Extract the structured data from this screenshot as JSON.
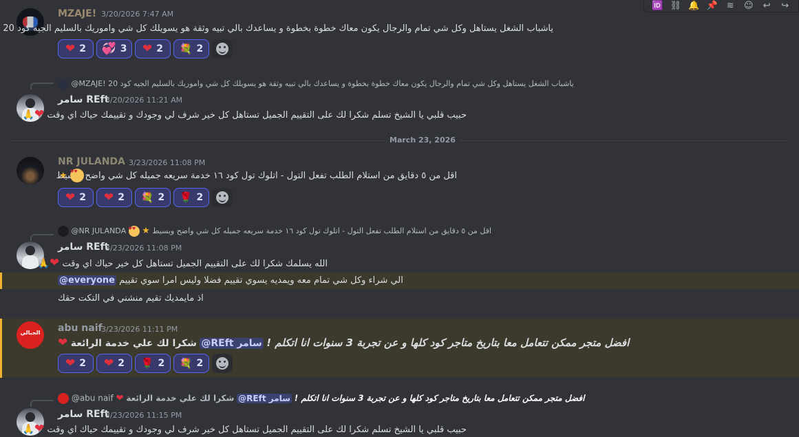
{
  "toolbar": {
    "icons": [
      "id-icon",
      "link-icon",
      "bell-icon",
      "pin-icon",
      "threads-icon",
      "emoji-icon",
      "reply-icon",
      "forward-icon"
    ]
  },
  "messages": [
    {
      "author": "MZAJE!",
      "timestamp": "3/20/2026 7:47 AM",
      "text": "ياشباب الشغل يستاهل وكل شي تمام والرجال يكون معاك خطوة بخطوة و يساعدك بالي تبيه وثقة هو يسويلك كل شي واموريك بالسليم الجيه كود 20",
      "reactions": [
        {
          "emoji": "heart",
          "count": "2"
        },
        {
          "emoji": "heart-sparkle",
          "count": "3"
        },
        {
          "emoji": "heart",
          "count": "2"
        },
        {
          "emoji": "bouquet",
          "count": "2"
        }
      ]
    },
    {
      "reply_author": "@MZAJE!",
      "reply_text": "ياشباب الشغل يستاهل وكل شي تمام والرجال يكون معاك خطوة بخطوة و يساعدك بالي تبيه وثقة هو يسويلك كل شي واموريك بالسليم الجيه كود 20",
      "author": "سامر REft",
      "timestamp": "3/20/2026 11:21 AM",
      "text": "حبيب قلبي يا الشيخ تسلم شكرا لك على التقييم الجميل تستاهل كل خير شرف لي وجودك و تقييمك حياك اي وقت"
    },
    {
      "divider": "March 23, 2026"
    },
    {
      "author": "NR JULANDA",
      "timestamp": "3/23/2026 11:08 PM",
      "text": "اقل من ٥ دقايق من استلام الطلب تفعل التول - اتلوك تول كود ١٦ خدمة سريعه جميله كل شي واضح وبسيط",
      "reactions": [
        {
          "emoji": "heart",
          "count": "2"
        },
        {
          "emoji": "heart",
          "count": "2"
        },
        {
          "emoji": "bouquet",
          "count": "2"
        },
        {
          "emoji": "rose",
          "count": "2"
        }
      ]
    },
    {
      "reply_author": "@NR JULANDA",
      "reply_text": "اقل من ٥ دقايق من استلام الطلب تفعل التول - اتلوك تول كود ١٦ خدمة سريعه جميله كل شي واضح وبسيط",
      "author": "سامر REft",
      "timestamp": "3/23/2026 11:08 PM",
      "text": "الله يسلمك شكرا لك على التقييم الجميل تستاهل كل خير حياك اي وقت",
      "line2_mention": "@everyone",
      "line2_text": "الي شراء وكل شي تمام معه ويمديه يسوي تقييم فضلا وليس امرا سوي تقييم",
      "line3_text": "اذ مايمديك تقيم منشني في التكت حقك"
    },
    {
      "author": "abu naif",
      "timestamp": "3/23/2026 11:11 PM",
      "text_bold": "افضل متجر ممكن تتعامل معا بتاريخ متاجر كود كلها و عن تجربة 3 سنوات انا اتكلم !",
      "mention": "@REft",
      "mention_prefix": "سامر",
      "text_tail": "شكرا لك علي خدمة الرائعة",
      "reactions": [
        {
          "emoji": "heart",
          "count": "2"
        },
        {
          "emoji": "heart",
          "count": "2"
        },
        {
          "emoji": "rose",
          "count": "2"
        },
        {
          "emoji": "bouquet",
          "count": "2"
        }
      ]
    },
    {
      "reply_author": "@abu naif",
      "reply_text_tail": "شكرا لك علي خدمة الرائعة",
      "reply_mention": "@REft",
      "reply_mention_prefix": "سامر",
      "reply_text_bold": "افضل متجر ممكن تتعامل معا بتاريخ متاجر كود كلها و عن تجربة 3 سنوات انا اتكلم !",
      "author": "سامر REft",
      "timestamp": "3/23/2026 11:15 PM",
      "text": "حبيب قلبي يا الشيخ تسلم شكرا لك على التقييم الجميل تستاهل كل خير شرف لي وجودك و تقييمك حياك اي وقت"
    }
  ],
  "colors": {
    "background": "#313338",
    "mzaje_name": "#9a8a6e",
    "refit_name": "#dbdee1",
    "nr_name": "#8d8672",
    "abu_name": "#949ba4",
    "reaction_bg": "#373a6b",
    "reaction_border": "#5865f2",
    "highlight": "#3c3a2d"
  }
}
